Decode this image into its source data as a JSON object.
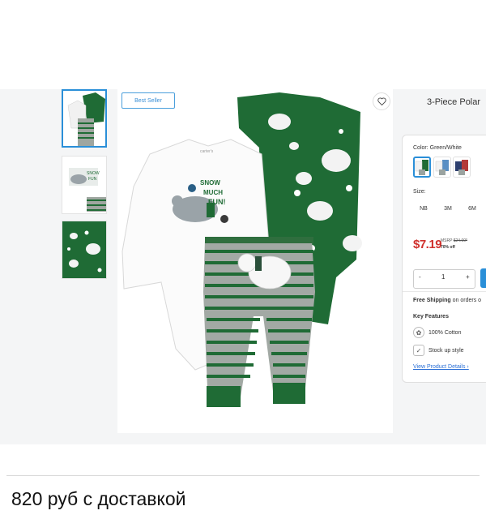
{
  "product": {
    "title": "3-Piece Polar",
    "badge": "Best Seller",
    "heart_icon": "heart-icon"
  },
  "gallery": {
    "thumb_count": 3,
    "main_graphic_text": "SNOW\nMUCH\nFUN!"
  },
  "panel": {
    "color_label": "Color:",
    "color_value": "Green/White",
    "size_label": "Size:",
    "sizes": [
      "NB",
      "3M",
      "6M"
    ],
    "price": "$7.19",
    "msrp_label": "MSRP",
    "msrp_value": "$24.00*",
    "discount": "70% off",
    "qty_minus": "-",
    "qty_value": "1",
    "qty_plus": "+",
    "shipping_bold": "Free Shipping",
    "shipping_rest": "on orders o",
    "key_features": "Key Features",
    "feature1": "100% Cotton",
    "feature2": "Stock up style",
    "details_link": "View Product Details",
    "details_arrow": "›"
  },
  "colors": {
    "accent": "#2a8fd8",
    "price_red": "#d0312d",
    "green": "#1f6b35"
  },
  "caption": "820 руб с доставкой"
}
